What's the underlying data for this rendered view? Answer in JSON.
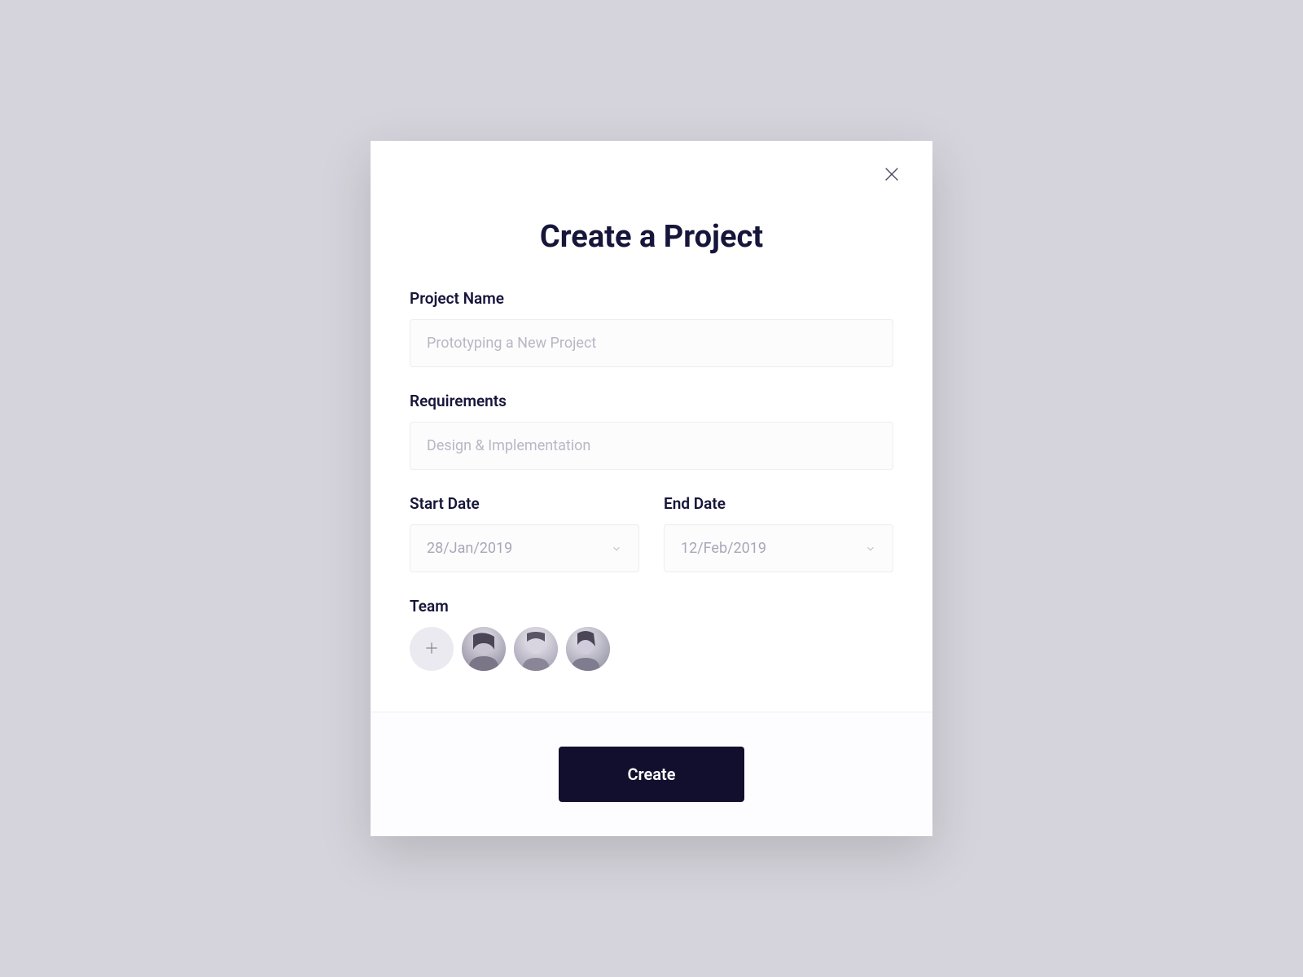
{
  "modal": {
    "title": "Create a Project",
    "fields": {
      "project_name": {
        "label": "Project Name",
        "placeholder": "Prototyping a New Project"
      },
      "requirements": {
        "label": "Requirements",
        "placeholder": "Design & Implementation"
      },
      "start_date": {
        "label": "Start Date",
        "value": "28/Jan/2019"
      },
      "end_date": {
        "label": "End Date",
        "value": "12/Feb/2019"
      },
      "team": {
        "label": "Team",
        "members": [
          "member-1",
          "member-2",
          "member-3"
        ]
      }
    },
    "actions": {
      "create_label": "Create"
    }
  }
}
